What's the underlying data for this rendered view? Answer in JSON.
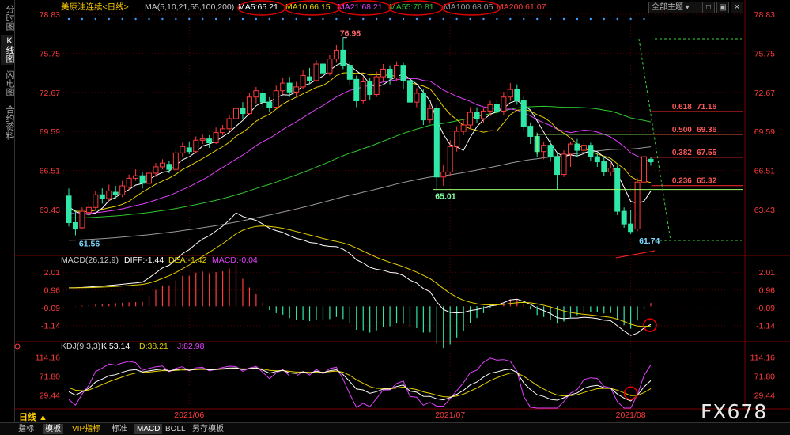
{
  "sidebar": {
    "tabs": [
      "分时图",
      "K线图",
      "闪电图",
      "合约资料"
    ],
    "active": 1
  },
  "window": {
    "theme_label": "全部主题",
    "btn_min": "□",
    "btn_restore": "▣",
    "btn_close": "✕"
  },
  "price_header": {
    "title": "美原油连续<日线>",
    "ma_params": "MA(5,10,21,55,100,200)",
    "ma5": "MA5:65.21",
    "ma10": "MA10:66.15",
    "ma21": "MA21:68.21",
    "ma55": "MA55:70.81",
    "ma100": "MA100:68.05",
    "ma200": "MA200:61.07"
  },
  "macd_header": {
    "title": "MACD(26,12,9)",
    "diff": "DIFF:-1.44",
    "dea": "DEA:-1.42",
    "macd": "MACD:-0.04"
  },
  "kdj_header": {
    "title": "KDJ(9,3,3)",
    "k": "K:53.14",
    "d": "D:38.21",
    "j": "J:82.98"
  },
  "colors": {
    "up": "#ff3b3b",
    "down": "#2fe8a8",
    "ma5": "#ffffff",
    "ma10": "#e6d000",
    "ma21": "#e040fb",
    "ma55": "#2ec52e",
    "ma100": "#9a9a9a",
    "fib_line": "#ff2a2a",
    "level": "#9cff6a",
    "axis_text": "#ff3b3b",
    "grid": "#5a0000"
  },
  "chart_data": [
    {
      "type": "candlestick",
      "title": "美原油连续<日线>",
      "x_labels": [
        "2021/06",
        "2021/07",
        "2021/08"
      ],
      "y_ticks": [
        "78.83",
        "75.75",
        "72.67",
        "69.59",
        "66.51",
        "63.43"
      ],
      "ylim": [
        60.5,
        78.83
      ],
      "annotations": {
        "high": "76.98",
        "low_first": "61.56",
        "low_second": "61.74",
        "support": "65.01"
      },
      "fib_levels": [
        {
          "ratio": "0.618",
          "price": "71.16"
        },
        {
          "ratio": "0.500",
          "price": "69.36"
        },
        {
          "ratio": "0.382",
          "price": "67.55"
        },
        {
          "ratio": "0.236",
          "price": "65.32"
        }
      ],
      "candles": [
        [
          64.5,
          62.4,
          65.1,
          62.1
        ],
        [
          62.4,
          61.9,
          63.4,
          61.4
        ],
        [
          62.0,
          63.3,
          63.6,
          61.9
        ],
        [
          63.2,
          63.6,
          64.0,
          62.8
        ],
        [
          63.6,
          64.6,
          64.9,
          63.4
        ],
        [
          64.6,
          64.3,
          65.1,
          63.9
        ],
        [
          64.3,
          64.9,
          65.4,
          64.1
        ],
        [
          64.8,
          64.6,
          65.3,
          64.3
        ],
        [
          64.6,
          65.3,
          65.7,
          64.4
        ],
        [
          65.2,
          65.9,
          66.2,
          65.0
        ],
        [
          65.9,
          66.1,
          66.6,
          65.7
        ],
        [
          66.1,
          65.5,
          66.4,
          65.1
        ],
        [
          65.5,
          66.3,
          66.7,
          65.3
        ],
        [
          66.3,
          66.8,
          67.1,
          66.0
        ],
        [
          66.8,
          67.1,
          67.4,
          66.6
        ],
        [
          67.0,
          66.6,
          67.3,
          66.3
        ],
        [
          66.6,
          67.9,
          68.2,
          66.5
        ],
        [
          67.9,
          68.4,
          68.7,
          67.6
        ],
        [
          68.3,
          68.0,
          68.8,
          67.8
        ],
        [
          68.0,
          68.9,
          69.2,
          67.9
        ],
        [
          68.9,
          69.0,
          69.4,
          68.6
        ],
        [
          69.0,
          68.7,
          69.3,
          68.3
        ],
        [
          68.7,
          69.5,
          69.9,
          68.6
        ],
        [
          69.5,
          69.8,
          70.1,
          69.3
        ],
        [
          69.8,
          70.6,
          70.9,
          69.6
        ],
        [
          70.6,
          71.4,
          71.8,
          70.3
        ],
        [
          71.4,
          71.0,
          71.9,
          70.6
        ],
        [
          71.0,
          72.3,
          72.6,
          70.9
        ],
        [
          72.3,
          72.8,
          73.1,
          71.8
        ],
        [
          72.6,
          71.9,
          72.9,
          71.5
        ],
        [
          71.9,
          71.5,
          72.3,
          71.1
        ],
        [
          71.5,
          72.8,
          73.2,
          71.4
        ],
        [
          72.8,
          73.4,
          73.8,
          72.5
        ],
        [
          73.4,
          72.7,
          73.9,
          72.3
        ],
        [
          72.7,
          73.1,
          73.5,
          72.4
        ],
        [
          73.1,
          74.0,
          74.4,
          72.9
        ],
        [
          73.9,
          73.6,
          74.6,
          73.3
        ],
        [
          73.6,
          74.9,
          75.2,
          73.5
        ],
        [
          74.9,
          74.2,
          75.4,
          73.9
        ],
        [
          74.2,
          75.3,
          75.6,
          74.0
        ],
        [
          75.3,
          76.0,
          76.4,
          75.0
        ],
        [
          76.0,
          74.8,
          76.98,
          74.5
        ],
        [
          74.8,
          73.7,
          75.1,
          73.2
        ],
        [
          73.7,
          72.0,
          74.0,
          71.5
        ],
        [
          72.0,
          73.5,
          73.9,
          71.8
        ],
        [
          73.5,
          72.5,
          73.8,
          72.1
        ],
        [
          72.5,
          73.9,
          74.3,
          72.3
        ],
        [
          73.9,
          74.5,
          74.9,
          73.5
        ],
        [
          74.5,
          73.8,
          74.8,
          73.3
        ],
        [
          73.8,
          74.8,
          75.1,
          73.6
        ],
        [
          74.8,
          73.6,
          75.0,
          72.9
        ],
        [
          73.6,
          71.9,
          73.9,
          71.6
        ],
        [
          71.9,
          72.6,
          73.0,
          71.5
        ],
        [
          72.6,
          70.5,
          72.9,
          70.1
        ],
        [
          70.5,
          71.4,
          71.7,
          70.2
        ],
        [
          71.4,
          66.0,
          71.7,
          65.01
        ],
        [
          66.0,
          66.4,
          67.0,
          65.3
        ],
        [
          66.4,
          68.4,
          68.9,
          66.1
        ],
        [
          68.4,
          69.6,
          70.0,
          68.0
        ],
        [
          69.6,
          70.1,
          70.6,
          69.3
        ],
        [
          70.1,
          71.1,
          71.5,
          69.8
        ],
        [
          71.1,
          70.6,
          71.5,
          70.3
        ],
        [
          70.6,
          71.2,
          71.4,
          70.3
        ],
        [
          71.2,
          71.7,
          72.0,
          70.8
        ],
        [
          71.7,
          71.2,
          72.1,
          70.8
        ],
        [
          71.2,
          72.3,
          72.7,
          70.9
        ],
        [
          72.3,
          72.9,
          73.4,
          72.0
        ],
        [
          72.9,
          72.0,
          73.3,
          71.7
        ],
        [
          72.0,
          70.0,
          72.4,
          69.7
        ],
        [
          70.0,
          69.2,
          70.3,
          68.6
        ],
        [
          69.2,
          68.0,
          69.5,
          67.6
        ],
        [
          68.0,
          68.5,
          68.8,
          67.4
        ],
        [
          68.5,
          67.6,
          68.9,
          67.2
        ],
        [
          67.6,
          66.2,
          67.9,
          65.0
        ],
        [
          66.2,
          67.8,
          68.1,
          66.0
        ],
        [
          67.8,
          68.6,
          68.8,
          66.8
        ],
        [
          68.6,
          68.1,
          69.0,
          67.6
        ],
        [
          68.1,
          68.5,
          68.9,
          67.8
        ],
        [
          68.5,
          67.6,
          68.7,
          67.3
        ],
        [
          67.6,
          67.2,
          67.9,
          66.8
        ],
        [
          67.2,
          66.4,
          67.6,
          66.1
        ],
        [
          66.4,
          66.7,
          67.1,
          66.1
        ],
        [
          66.7,
          63.3,
          66.9,
          63.0
        ],
        [
          63.3,
          62.3,
          63.6,
          62.0
        ],
        [
          62.3,
          61.7,
          63.4,
          61.5
        ],
        [
          61.9,
          65.6,
          65.9,
          61.74
        ],
        [
          65.6,
          67.6,
          67.8,
          65.4
        ],
        [
          67.4,
          67.2,
          67.6,
          66.9
        ]
      ]
    },
    {
      "type": "macd",
      "title": "MACD(26,12,9)",
      "y_ticks": [
        "2.01",
        "0.96",
        "-0.09",
        "-1.14"
      ],
      "ylim": [
        -1.9,
        2.3
      ]
    },
    {
      "type": "kdj",
      "title": "KDJ(9,3,3)",
      "y_ticks": [
        "114.16",
        "71.80",
        "29.44"
      ],
      "ylim": [
        0,
        124
      ]
    }
  ],
  "bottom": {
    "period": "日线 ▲",
    "tabs": [
      "指标",
      "模板",
      "VIP指标",
      "标准",
      "MACD",
      "BOLL",
      "另存模板"
    ],
    "watermark": "FX678"
  }
}
